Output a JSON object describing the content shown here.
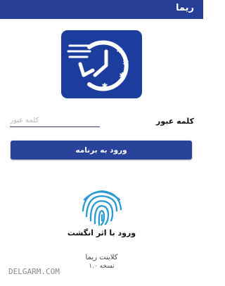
{
  "appbar": {
    "title": "ریما",
    "color": "#283f97"
  },
  "logo": {
    "icon": "clock-history-icon",
    "background": "#1d3d9e"
  },
  "login": {
    "password_label": "کلمه عبور",
    "password_placeholder": "کلمه عبور",
    "password_value": "",
    "button_label": "ورود به برنامه",
    "button_color": "#29439b"
  },
  "fingerprint": {
    "icon": "fingerprint-icon",
    "label": "ورود با اثر انگشت"
  },
  "footer": {
    "client": "کلاینت ریما",
    "version": "نسخه ۱.۰"
  },
  "watermark": "DELGARM.COM"
}
